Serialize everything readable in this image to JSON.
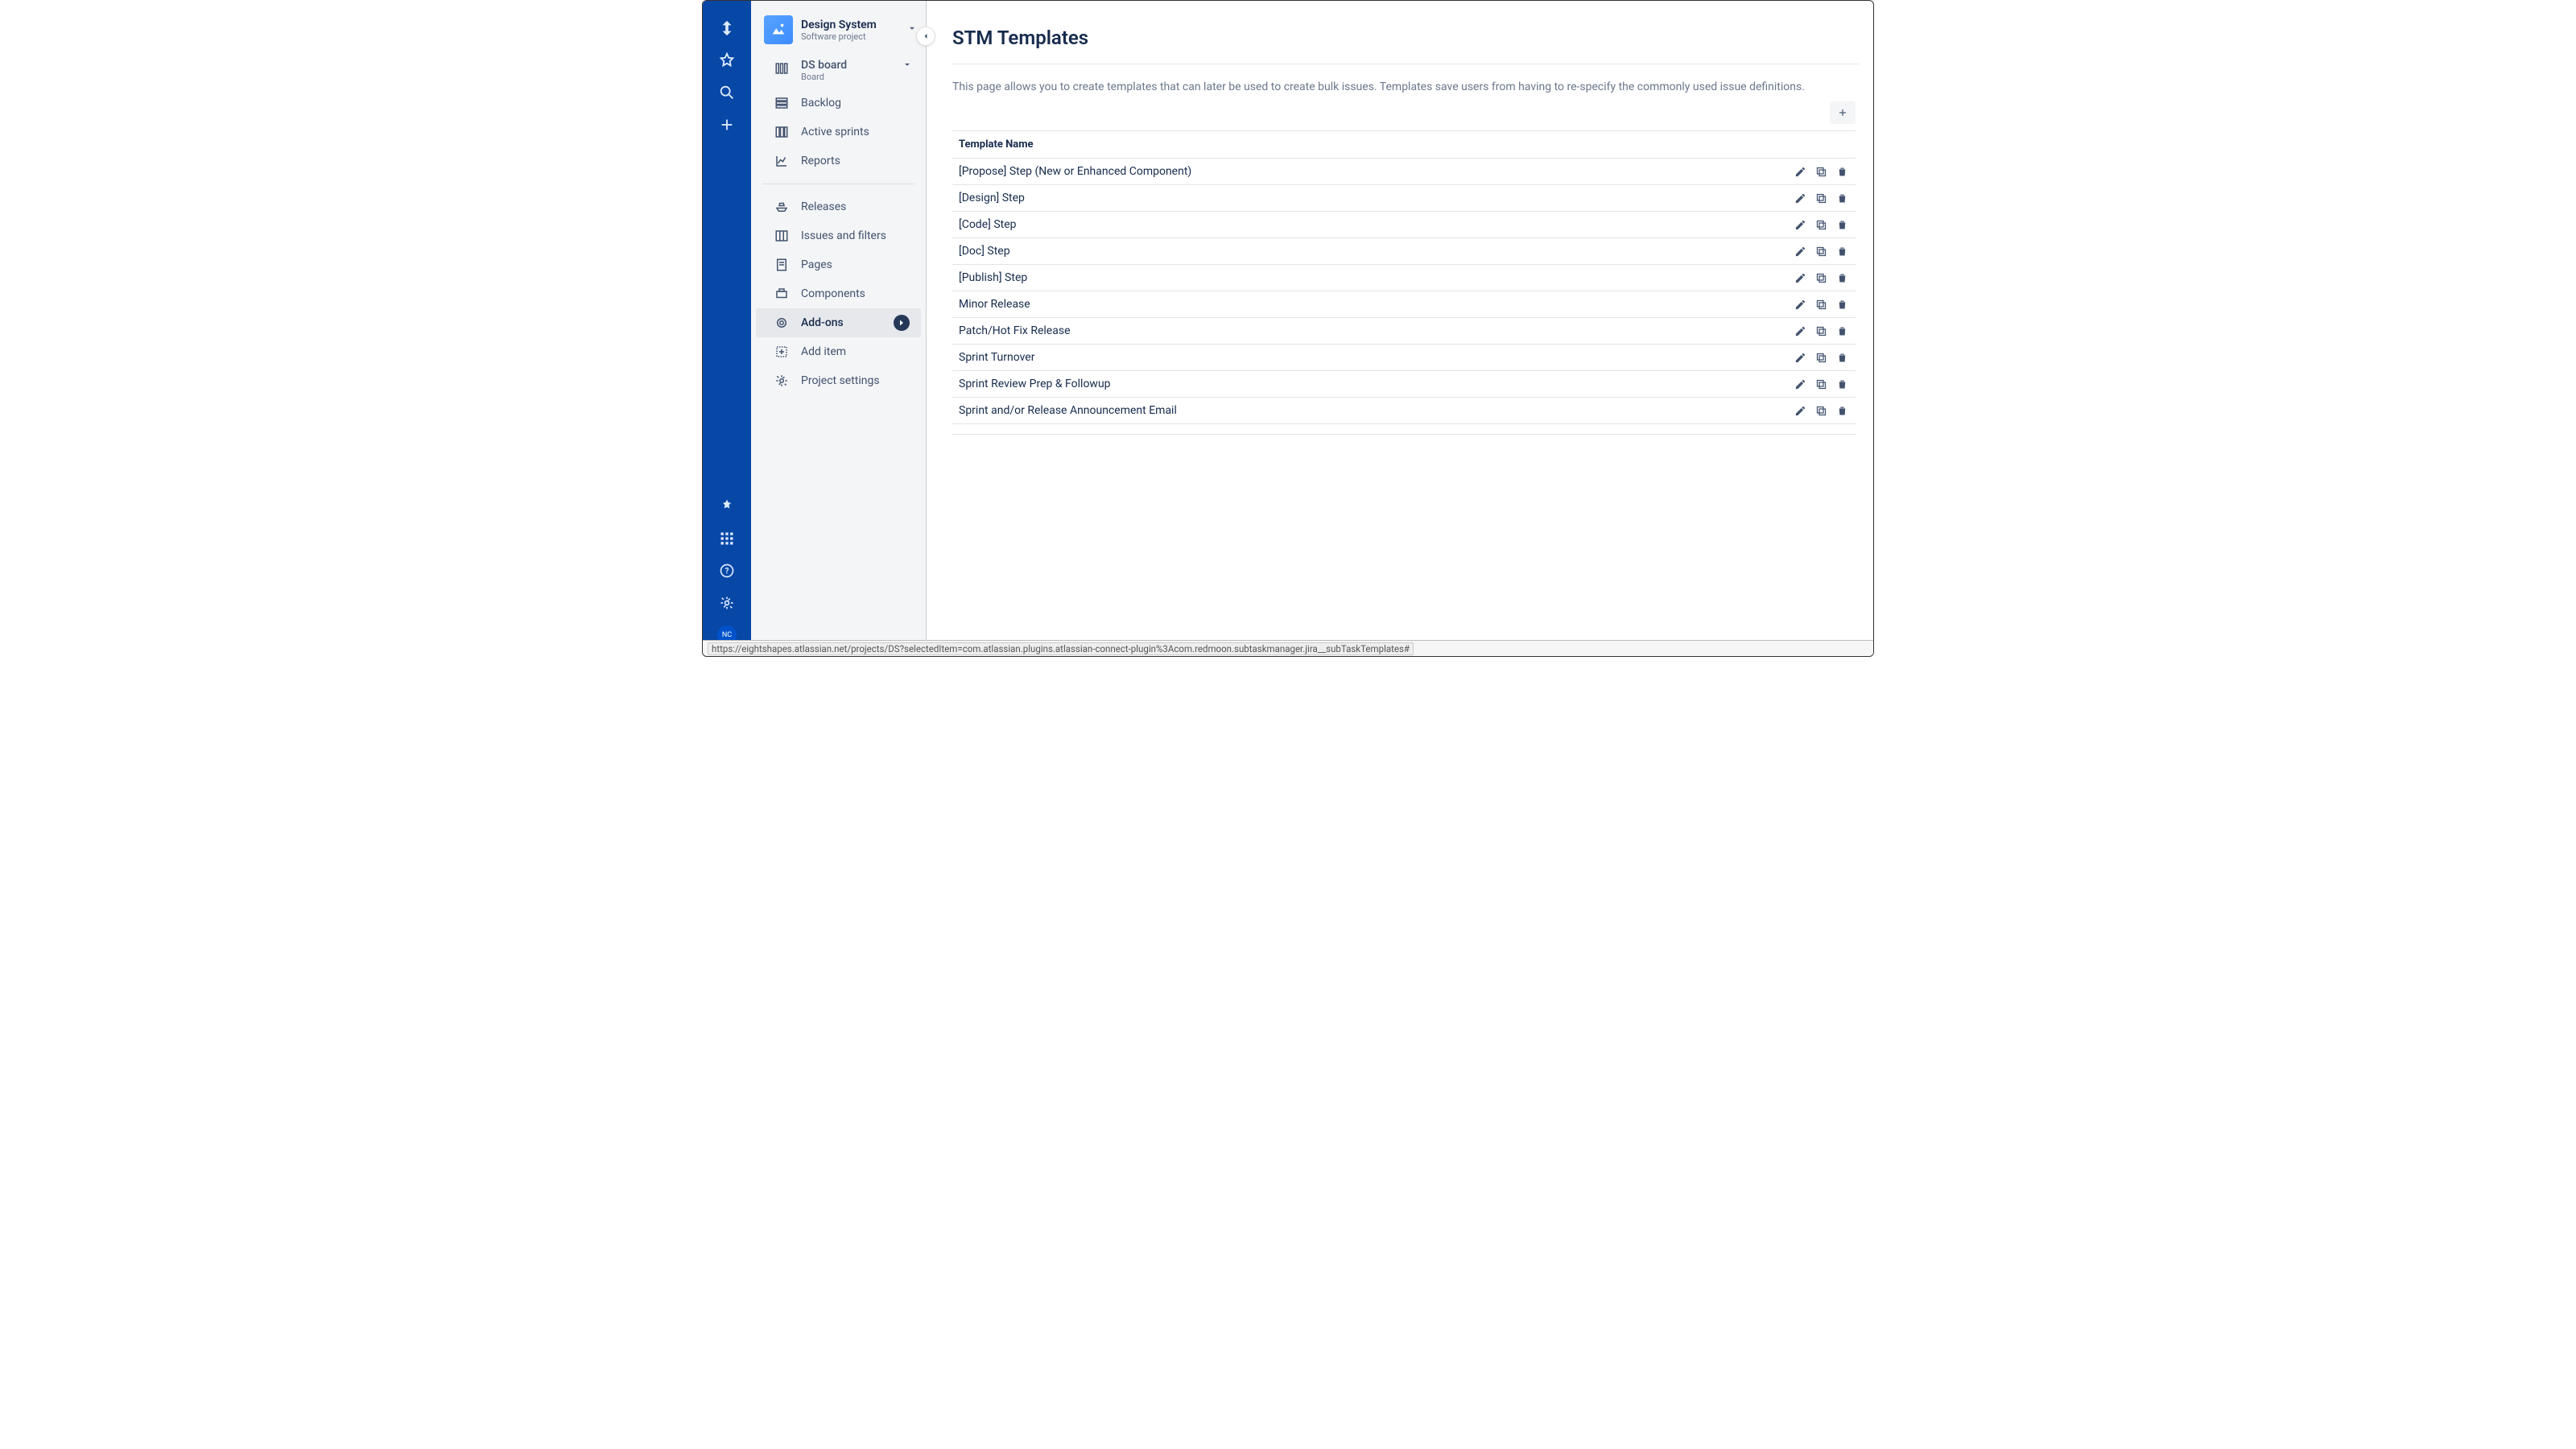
{
  "globalNav": {
    "avatarInitials": "NC"
  },
  "project": {
    "name": "Design System",
    "type": "Software project"
  },
  "board": {
    "title": "DS board",
    "subtitle": "Board"
  },
  "sidebar": {
    "primary": [
      {
        "id": "backlog",
        "label": "Backlog",
        "icon": "backlog"
      },
      {
        "id": "sprints",
        "label": "Active sprints",
        "icon": "columns"
      },
      {
        "id": "reports",
        "label": "Reports",
        "icon": "chart"
      }
    ],
    "secondary": [
      {
        "id": "releases",
        "label": "Releases",
        "icon": "ship"
      },
      {
        "id": "issues",
        "label": "Issues and filters",
        "icon": "board2"
      },
      {
        "id": "pages",
        "label": "Pages",
        "icon": "page"
      },
      {
        "id": "components",
        "label": "Components",
        "icon": "component"
      },
      {
        "id": "addons",
        "label": "Add-ons",
        "icon": "ring",
        "selected": true,
        "badge": true
      },
      {
        "id": "additem",
        "label": "Add item",
        "icon": "addsq"
      },
      {
        "id": "settings",
        "label": "Project settings",
        "icon": "gear"
      }
    ]
  },
  "page": {
    "title": "STM Templates",
    "description": "This page allows you to create templates that can later be used to create bulk issues. Templates save users from having to re-specify the commonly used issue definitions.",
    "columnHeader": "Template Name"
  },
  "templates": [
    {
      "name": "[Propose] Step (New or Enhanced Component)"
    },
    {
      "name": "[Design] Step"
    },
    {
      "name": "[Code] Step"
    },
    {
      "name": "[Doc] Step"
    },
    {
      "name": "[Publish] Step"
    },
    {
      "name": "Minor Release"
    },
    {
      "name": "Patch/Hot Fix Release"
    },
    {
      "name": "Sprint Turnover"
    },
    {
      "name": "Sprint Review Prep & Followup"
    },
    {
      "name": "Sprint and/or Release Announcement Email"
    }
  ],
  "statusUrl": "https://eightshapes.atlassian.net/projects/DS?selectedItem=com.atlassian.plugins.atlassian-connect-plugin%3Acom.redmoon.subtaskmanager.jira__subTaskTemplates#"
}
